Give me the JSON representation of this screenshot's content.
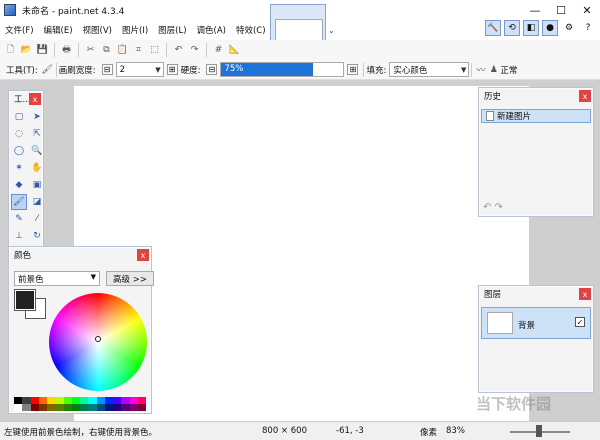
{
  "window": {
    "title": "未命名 - paint.net 4.3.4"
  },
  "menu": [
    "文件(F)",
    "编辑(E)",
    "视图(V)",
    "图片(I)",
    "图层(L)",
    "调色(A)",
    "特效(C)"
  ],
  "toolbar": {
    "tool_label": "工具(T):",
    "brush_width_label": "画刷宽度:",
    "brush_width_value": "2",
    "hardness_label": "硬度:",
    "hardness_value": "75%",
    "hardness_percent": 75,
    "fill_label": "填充:",
    "fill_value": "实心颜色",
    "blend_mode": "正常"
  },
  "tools_panel": {
    "title": "工..."
  },
  "colors_panel": {
    "title": "颜色",
    "primary_select": "前景色",
    "advanced_button": "高级 >>",
    "primary_color": "#222222",
    "secondary_color": "#ffffff"
  },
  "history_panel": {
    "title": "历史",
    "items": [
      "新建图片"
    ]
  },
  "layers_panel": {
    "title": "图层",
    "layers": [
      {
        "name": "背景",
        "visible": true
      }
    ]
  },
  "status": {
    "hint": "左键使用前景色绘制，右键使用背景色。",
    "image_size": "800 × 600",
    "cursor_pos": "-61, -3",
    "unit": "像素",
    "zoom": "83%"
  },
  "watermark": "当下软件园",
  "palette": [
    "#000000",
    "#404040",
    "#ff0000",
    "#ff6a00",
    "#ffd800",
    "#b6ff00",
    "#4cff00",
    "#00ff21",
    "#00ff90",
    "#00ffff",
    "#0094ff",
    "#0026ff",
    "#4800ff",
    "#b200ff",
    "#ff00dc",
    "#ff006e",
    "#ffffff",
    "#808080",
    "#7f0000",
    "#7f3300",
    "#7f6a00",
    "#5b7f00",
    "#267f00",
    "#007f0e",
    "#007f46",
    "#007f7f",
    "#004a7f",
    "#00137f",
    "#21007f",
    "#57007f",
    "#7f006e",
    "#7f0037"
  ]
}
